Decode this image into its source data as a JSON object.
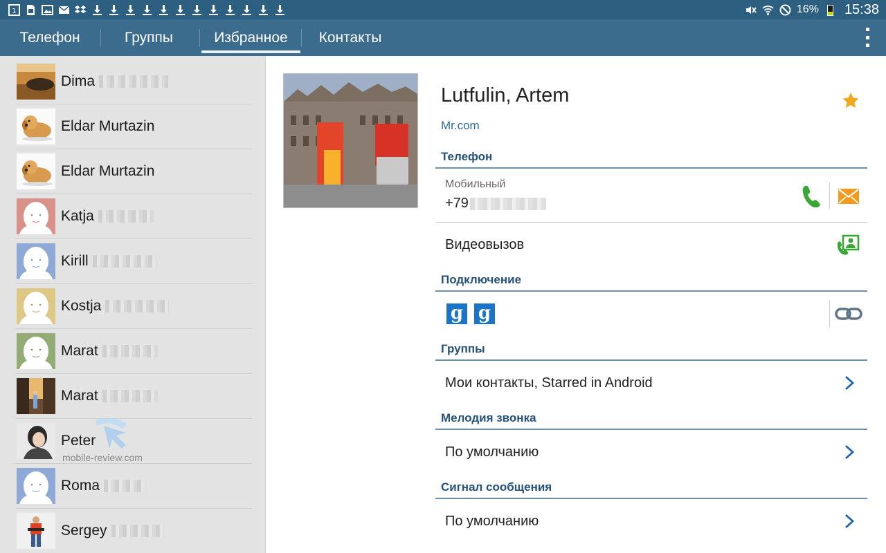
{
  "status_bar": {
    "battery_pct": "16%",
    "time": "15:38"
  },
  "tabs": [
    {
      "label": "Телефон"
    },
    {
      "label": "Группы"
    },
    {
      "label": "Избранное"
    },
    {
      "label": "Контакты"
    }
  ],
  "favorites": [
    {
      "name": "Dima",
      "avatar": "photo-floor"
    },
    {
      "name": "Eldar Murtazin",
      "avatar": "toy-dog"
    },
    {
      "name": "Eldar Murtazin",
      "avatar": "toy-dog"
    },
    {
      "name": "Katja",
      "avatar": "default-red"
    },
    {
      "name": "Kirill",
      "avatar": "default-blue"
    },
    {
      "name": "Kostja",
      "avatar": "default-yellow"
    },
    {
      "name": "Marat",
      "avatar": "default-green"
    },
    {
      "name": "Marat",
      "avatar": "photo-street"
    },
    {
      "name": "Peter",
      "avatar": "photo-person"
    },
    {
      "name": "Roma",
      "avatar": "default-blue"
    },
    {
      "name": "Sergey",
      "avatar": "photo-skater"
    }
  ],
  "watermark": "mobile-review.com",
  "detail": {
    "name": "Lutfulin, Artem",
    "organization": "Mr.com",
    "sections": {
      "phone": "Телефон",
      "connection": "Подключение",
      "groups": "Группы",
      "ringtone": "Мелодия звонка",
      "message_signal": "Сигнал сообщения"
    },
    "phone_type": "Мобильный",
    "phone_number": "+79",
    "video_call": "Видеовызов",
    "connection_badge": "g",
    "groups_value": "Мои контакты, Starred in Android",
    "ringtone_value": "По умолчанию",
    "message_signal_value": "По умолчанию"
  },
  "colors": {
    "status_bar": "#2c5f80",
    "tab_bar": "#3b6b8d",
    "section_header": "#24527a",
    "call_green": "#3aa635",
    "message_orange": "#f29a1c",
    "star": "#f2a81c"
  }
}
